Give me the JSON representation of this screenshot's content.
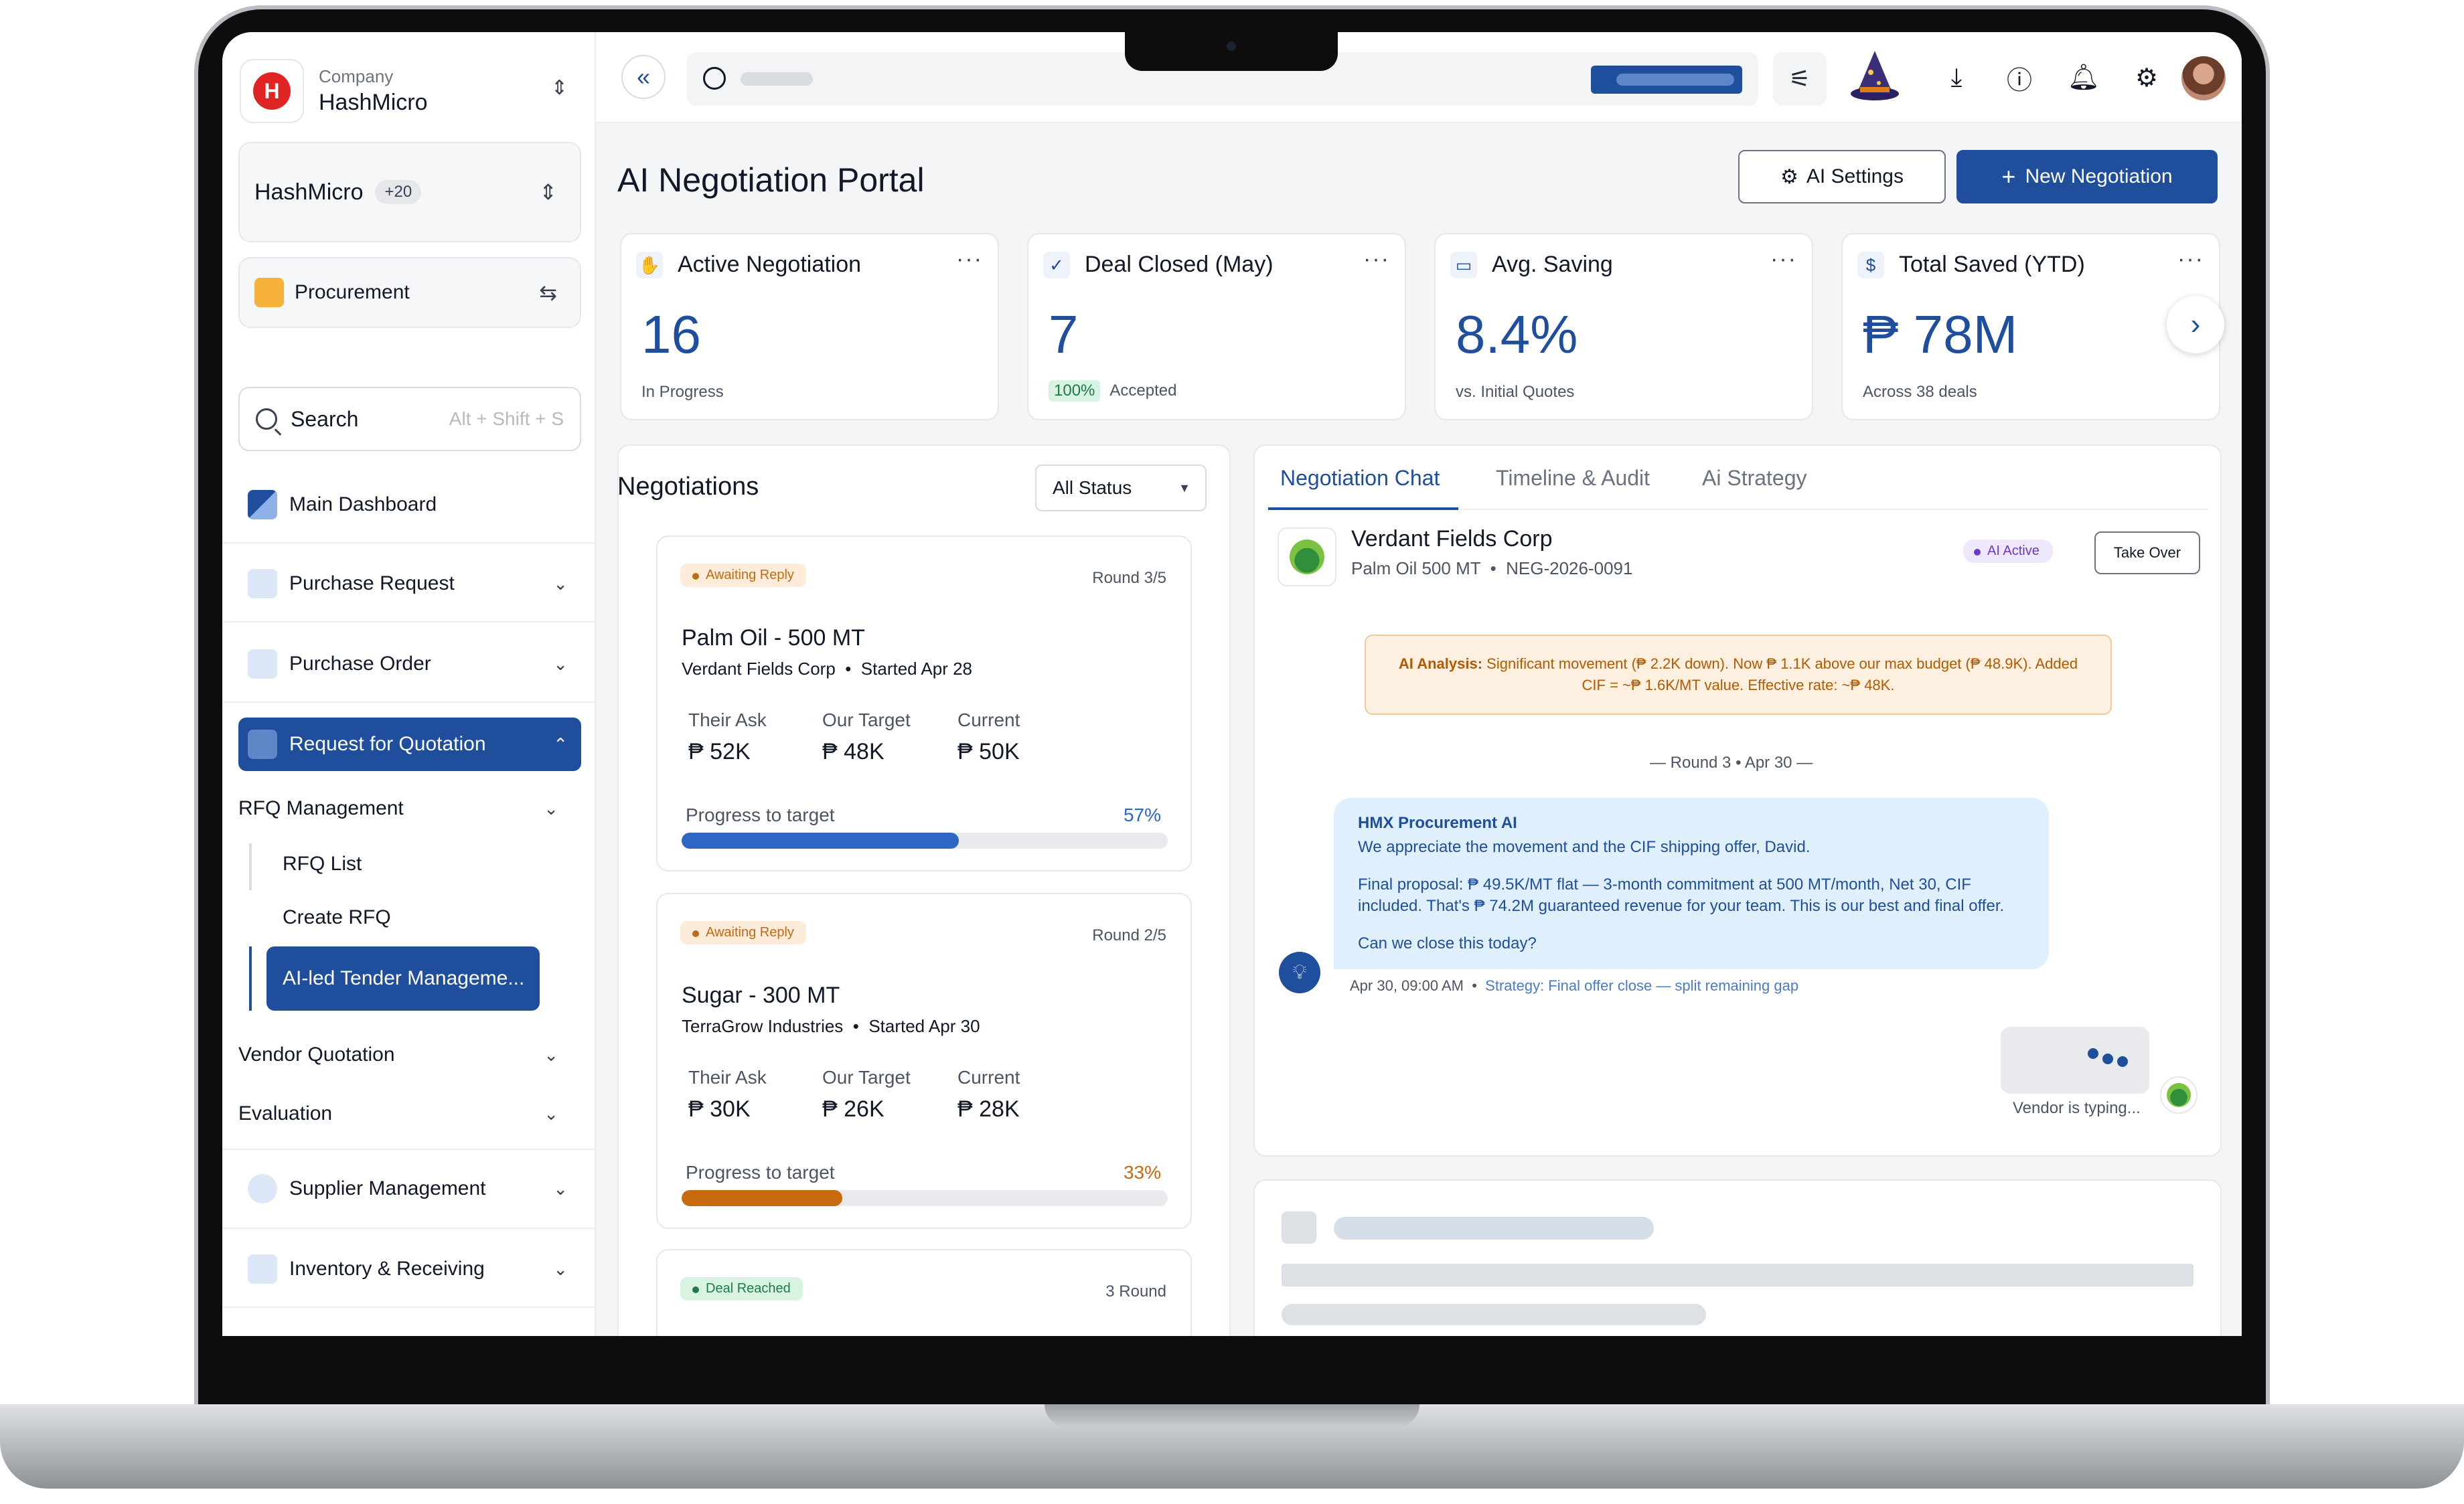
{
  "company": {
    "label": "Company",
    "name": "HashMicro"
  },
  "workspace": {
    "name": "HashMicro",
    "extra": "+20"
  },
  "module": {
    "label": "Procurement"
  },
  "sidebar_search": {
    "label": "Search",
    "shortcut": "Alt + Shift + S"
  },
  "nav": {
    "main_dashboard": "Main Dashboard",
    "purchase_request": "Purchase Request",
    "purchase_order": "Purchase Order",
    "rfq": "Request for Quotation",
    "rfq_management": "RFQ Management",
    "rfq_list": "RFQ List",
    "create_rfq": "Create RFQ",
    "ai_tender": "AI-led Tender Manageme...",
    "vendor_quotation": "Vendor Quotation",
    "evaluation": "Evaluation",
    "supplier_management": "Supplier Management",
    "inventory_receiving": "Inventory & Receiving"
  },
  "page": {
    "title": "AI Negotiation Portal",
    "settings_label": "AI Settings",
    "new_label": "New Negotiation"
  },
  "stats": [
    {
      "title": "Active Negotiation",
      "value": "16",
      "sub": "In Progress",
      "icon": "handshake-icon"
    },
    {
      "title": "Deal Closed (May)",
      "value": "7",
      "pill": "100%",
      "sub": "Accepted",
      "icon": "check-icon"
    },
    {
      "title": "Avg. Saving",
      "value": "8.4%",
      "sub": "vs. Initial Quotes",
      "icon": "wallet-icon"
    },
    {
      "title": "Total Saved (YTD)",
      "value": "₱ 78M",
      "sub": "Across 38 deals",
      "icon": "money-icon"
    }
  ],
  "negotiations": {
    "title": "Negotiations",
    "filter": "All Status",
    "cards": [
      {
        "status": "Awaiting Reply",
        "round": "Round 3/5",
        "title": "Palm Oil - 500 MT",
        "vendor": "Verdant Fields Corp",
        "started": "Started Apr 28",
        "ask_label": "Their Ask",
        "ask": "₱ 52K",
        "target_label": "Our Target",
        "target": "₱ 48K",
        "current_label": "Current",
        "current": "₱ 50K",
        "progress_label": "Progress to target",
        "progress_text": "57%",
        "progress": 0.57,
        "color": "#2f66c4"
      },
      {
        "status": "Awaiting Reply",
        "round": "Round 2/5",
        "title": "Sugar - 300 MT",
        "vendor": "TerraGrow Industries",
        "started": "Started Apr 30",
        "ask_label": "Their Ask",
        "ask": "₱ 30K",
        "target_label": "Our Target",
        "target": "₱ 26K",
        "current_label": "Current",
        "current": "₱ 28K",
        "progress_label": "Progress to target",
        "progress_text": "33%",
        "progress": 0.33,
        "color": "#c76a0e"
      },
      {
        "status": "Deal Reached",
        "round": "3 Round"
      }
    ]
  },
  "chat": {
    "tabs": [
      "Negotiation Chat",
      "Timeline & Audit",
      "Ai Strategy"
    ],
    "vendor": "Verdant Fields Corp",
    "product": "Palm Oil 500 MT",
    "ref": "NEG-2026-0091",
    "ai_status": "AI Active",
    "take_over": "Take Over",
    "analysis_label": "AI Analysis:",
    "analysis_text": "Significant movement (₱ 2.2K down). Now ₱ 1.1K above our max budget (₱ 48.9K). Added CIF = ~₱ 1.6K/MT value. Effective rate: ~₱ 48K.",
    "round_sep": "— Round 3 • Apr 30 —",
    "bot_name": "HMX Procurement AI",
    "msg1": "We appreciate the movement and the CIF shipping offer, David.",
    "msg2": "Final proposal: ₱ 49.5K/MT flat — 3-month commitment at 500 MT/month, Net 30, CIF included. That's ₱ 74.2M guaranteed revenue for your team. This is our best and final offer.",
    "msg3": "Can we close this today?",
    "time": "Apr 30, 09:00 AM",
    "strategy": "Strategy: Final offer close — split remaining gap",
    "typing": "Vendor is typing..."
  },
  "colors": {
    "primary": "#1e4e9c",
    "awaiting": "#c26a12",
    "deal": "#1f7a46"
  }
}
